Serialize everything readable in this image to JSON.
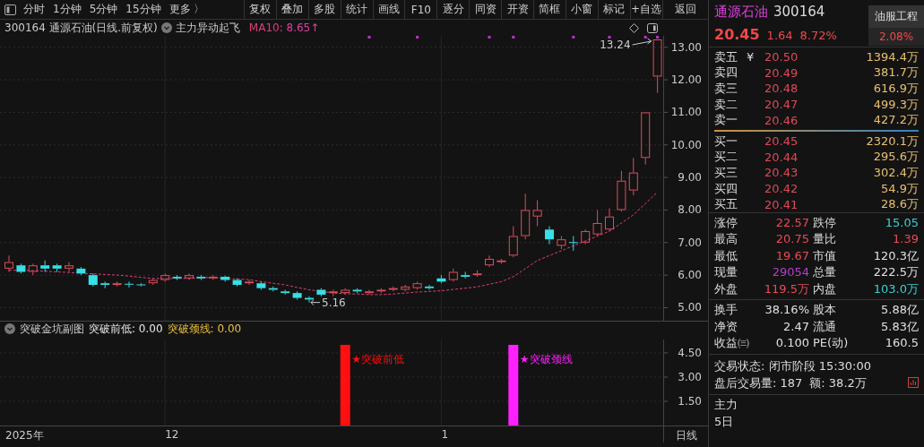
{
  "toolbar": {
    "periods": [
      "分时",
      "1分钟",
      "5分钟",
      "15分钟",
      "更多 〉"
    ],
    "buttons": [
      "复权",
      "叠加",
      "多股",
      "统计",
      "画线",
      "F10",
      "逐分",
      "同资",
      "开资",
      "简框",
      "小窗",
      "标记",
      "+自选",
      "返回"
    ]
  },
  "chart_header": {
    "title": "300164 通源石油(日线.前复权)",
    "indicator": "主力异动起飞",
    "ma_value": ": 8.65↑"
  },
  "main_chart": {
    "chart_data": {
      "type": "line",
      "grid": true,
      "ylim": [
        4.6,
        13.35
      ],
      "yticks": [
        {
          "value": 5,
          "label": "5.00"
        },
        {
          "value": 6,
          "label": "6.00"
        },
        {
          "value": 7,
          "label": "7.00"
        },
        {
          "value": 8,
          "label": "8.00"
        },
        {
          "value": 9,
          "label": "9.00"
        },
        {
          "value": 10,
          "label": "10.00"
        },
        {
          "value": 11,
          "label": "11.00"
        },
        {
          "value": 12,
          "label": "12.00"
        },
        {
          "value": 13,
          "label": "13.00"
        }
      ],
      "series": [
        {
          "name": "MA10",
          "color": "#d8407a",
          "line_style": "dashed",
          "values": [
            6.15,
            6.15,
            6.14,
            6.12,
            6.1,
            6.08,
            6.06,
            6.04,
            6.02,
            6.0,
            5.97,
            5.93,
            5.9,
            5.89,
            5.9,
            5.9,
            5.92,
            5.93,
            5.9,
            5.88,
            5.86,
            5.8,
            5.75,
            5.7,
            5.62,
            5.55,
            5.5,
            5.45,
            5.43,
            5.42,
            5.4,
            5.4,
            5.42,
            5.45,
            5.48,
            5.5,
            5.52,
            5.56,
            5.6,
            5.64,
            5.72,
            5.8,
            5.95,
            6.2,
            6.45,
            6.6,
            6.75,
            6.9,
            7.05,
            7.2,
            7.35,
            7.6,
            7.85,
            8.2,
            8.55
          ]
        }
      ],
      "annotations": [
        "13.24",
        "5.16"
      ]
    }
  },
  "sub_chart": {
    "title": "突破金坑副图",
    "legend": [
      {
        "value": ": 0.00",
        "color": "#e8e8e8"
      },
      {
        "value": ": 0.00",
        "color": "#e8c040"
      }
    ],
    "chart_data": {
      "type": "bar",
      "grid": true,
      "ylim": [
        0,
        5.33
      ],
      "yticks": [
        {
          "value": 1.5,
          "label": "1.50"
        },
        {
          "value": 3,
          "label": "3.00"
        },
        {
          "value": 4.5,
          "label": "4.50"
        }
      ],
      "series": [
        {
          "name": "突破前低",
          "color": "#ff1010",
          "values": [
            null,
            null,
            null,
            null,
            null,
            null,
            null,
            null,
            null,
            null,
            null,
            null,
            null,
            null,
            null,
            null,
            null,
            null,
            null,
            null,
            null,
            null,
            null,
            null,
            null,
            null,
            null,
            null,
            5,
            null,
            null,
            null,
            null,
            null,
            null,
            null,
            null,
            null,
            null,
            null,
            null,
            null,
            null,
            null,
            null,
            null,
            null,
            null,
            null,
            null,
            null,
            null,
            null,
            null,
            null
          ]
        },
        {
          "name": "突破颈线",
          "color": "#ff20ff",
          "values": [
            null,
            null,
            null,
            null,
            null,
            null,
            null,
            null,
            null,
            null,
            null,
            null,
            null,
            null,
            null,
            null,
            null,
            null,
            null,
            null,
            null,
            null,
            null,
            null,
            null,
            null,
            null,
            null,
            null,
            null,
            null,
            null,
            null,
            null,
            null,
            null,
            null,
            null,
            null,
            null,
            null,
            null,
            5,
            null,
            null,
            null,
            null,
            null,
            null,
            null,
            null,
            null,
            null,
            null,
            null
          ]
        }
      ],
      "annotations": [
        "★突破前低",
        "★突破颈线"
      ]
    },
    "x_axis_labels": [
      "2025年",
      "12",
      "1"
    ],
    "period_label": "日线"
  },
  "quote": {
    "name": "通源石油",
    "code": "300164",
    "sector": "油服工程",
    "sector_change": "2.08%",
    "price": "20.45",
    "change": "1.64",
    "change_pct": "8.72%"
  },
  "order_book": {
    "currency": "¥",
    "asks": [
      {
        "label": "卖五",
        "price": "20.50",
        "volume": "1394.4万"
      },
      {
        "label": "卖四",
        "price": "20.49",
        "volume": "381.7万"
      },
      {
        "label": "卖三",
        "price": "20.48",
        "volume": "616.9万"
      },
      {
        "label": "卖二",
        "price": "20.47",
        "volume": "499.3万"
      },
      {
        "label": "卖一",
        "price": "20.46",
        "volume": "427.2万"
      }
    ],
    "bids": [
      {
        "label": "买一",
        "price": "20.45",
        "volume": "2320.1万"
      },
      {
        "label": "买二",
        "price": "20.44",
        "volume": "295.6万"
      },
      {
        "label": "买三",
        "price": "20.43",
        "volume": "302.4万"
      },
      {
        "label": "买四",
        "price": "20.42",
        "volume": "54.9万"
      },
      {
        "label": "买五",
        "price": "20.41",
        "volume": "28.6万"
      }
    ]
  },
  "stats": [
    [
      {
        "label": "涨停",
        "value": "22.57",
        "color": "#e84a55"
      },
      {
        "label": "跌停",
        "value": "15.05",
        "color": "#3cd0d0"
      },
      {
        "label": "最高",
        "value": "20.75",
        "color": "#e84a55"
      },
      {
        "label": "量比",
        "value": "1.39",
        "color": "#e84a55"
      },
      {
        "label": "最低",
        "value": "19.67",
        "color": "#e84a55"
      },
      {
        "label": "市值",
        "value": "120.3亿",
        "color": "#e0e0e0"
      },
      {
        "label": "现量",
        "value": "29054",
        "color": "#b040d0"
      },
      {
        "label": "总量",
        "value": "222.5万",
        "color": "#e0e0e0"
      },
      {
        "label": "外盘",
        "value": "119.5万",
        "color": "#e84a55"
      },
      {
        "label": "内盘",
        "value": "103.0万",
        "color": "#3cd0d0"
      }
    ],
    [
      {
        "label": "换手",
        "value": "38.16%",
        "color": "#e0e0e0"
      },
      {
        "label": "股本",
        "value": "5.88亿",
        "color": "#e0e0e0"
      },
      {
        "label": "净资",
        "value": "2.47",
        "color": "#e0e0e0"
      },
      {
        "label": "流通",
        "value": "5.83亿",
        "color": "#e0e0e0"
      },
      {
        "label": "收益㈢",
        "value": "0.100",
        "color": "#e0e0e0"
      },
      {
        "label": "PE(动)",
        "value": "160.5",
        "color": "#e0e0e0"
      }
    ]
  ],
  "trade_status": {
    "status": "交易状态: 闭市阶段 15:30:00",
    "after_hours_volume": "盘后交易量: 187",
    "after_hours_amount": "额: 38.2万"
  },
  "fund_flow": [
    "主力",
    "5日"
  ]
}
